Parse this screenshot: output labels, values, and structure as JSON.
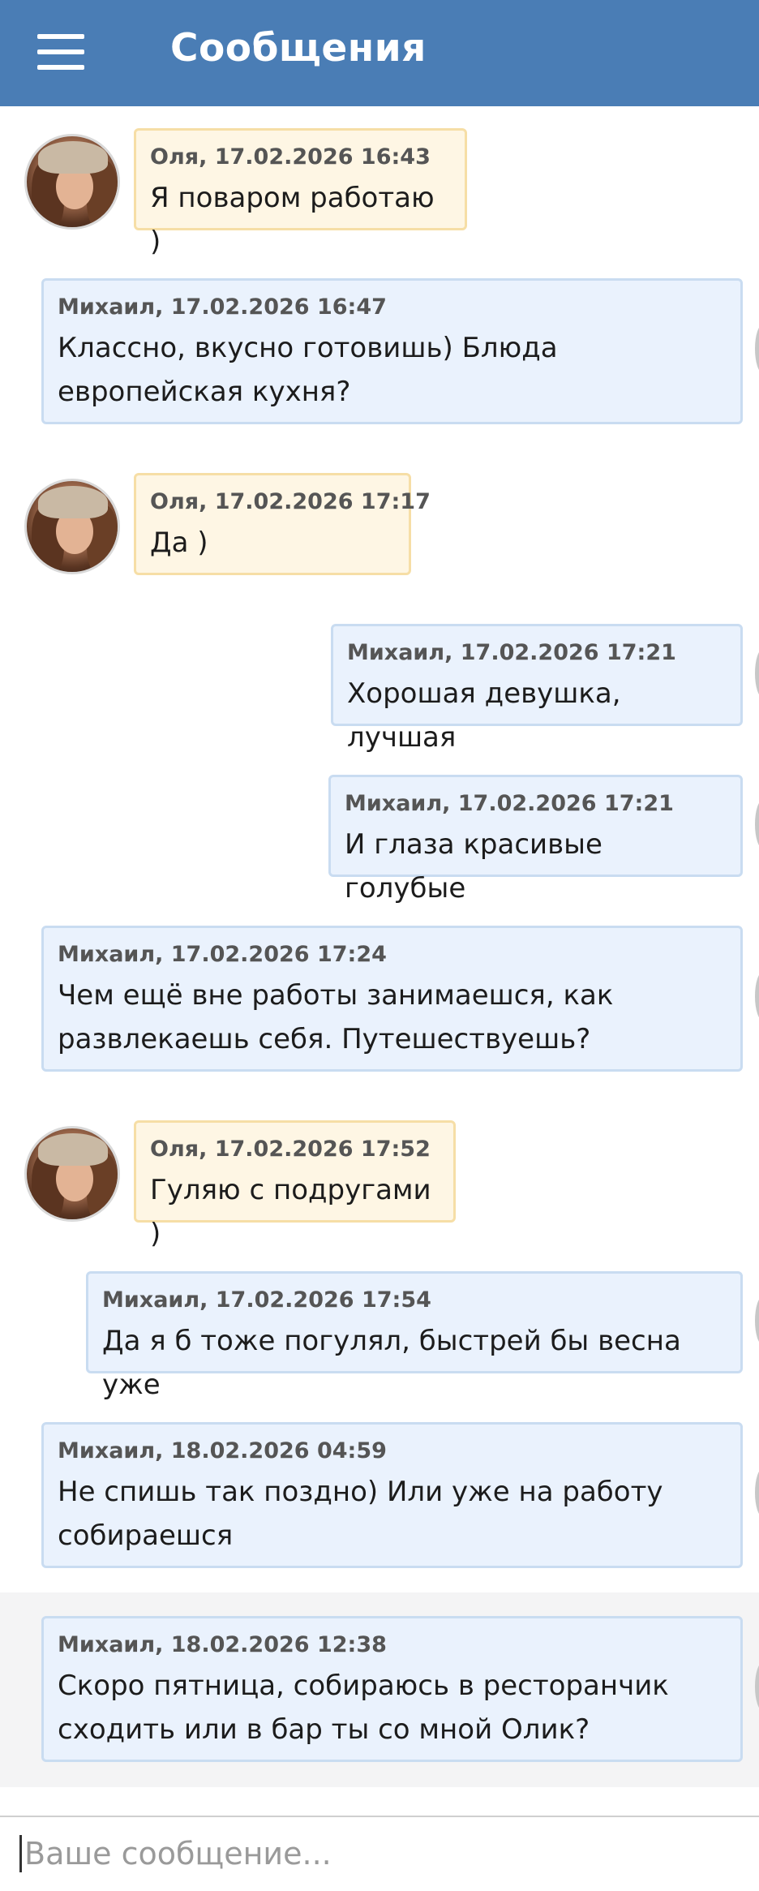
{
  "header": {
    "menu_icon": "hamburger-menu-icon",
    "title": "Сообщения"
  },
  "messages": [
    {
      "author": "Оля",
      "datetime": "17.02.2026 16:43",
      "meta": "Оля, 17.02.2026 16:43",
      "text": "Я поваром работаю )",
      "side": "theirs"
    },
    {
      "author": "Михаил",
      "datetime": "17.02.2026 16:47",
      "meta": "Михаил, 17.02.2026 16:47",
      "text": "Классно, вкусно готовишь) Блюда\nевропейская кухня?",
      "side": "mine"
    },
    {
      "author": "Оля",
      "datetime": "17.02.2026 17:17",
      "meta": "Оля, 17.02.2026 17:17",
      "text": "Да )",
      "side": "theirs"
    },
    {
      "author": "Михаил",
      "datetime": "17.02.2026 17:21",
      "meta": "Михаил, 17.02.2026 17:21",
      "text": "Хорошая девушка, лучшая",
      "side": "mine"
    },
    {
      "author": "Михаил",
      "datetime": "17.02.2026 17:21",
      "meta": "Михаил, 17.02.2026 17:21",
      "text": "И глаза красивые голубые",
      "side": "mine"
    },
    {
      "author": "Михаил",
      "datetime": "17.02.2026 17:24",
      "meta": "Михаил, 17.02.2026 17:24",
      "text": "Чем ещё вне работы занимаешся, как\nразвлекаешь себя. Путешествуешь?",
      "side": "mine"
    },
    {
      "author": "Оля",
      "datetime": "17.02.2026 17:52",
      "meta": "Оля, 17.02.2026 17:52",
      "text": "Гуляю с подругами )",
      "side": "theirs"
    },
    {
      "author": "Михаил",
      "datetime": "17.02.2026 17:54",
      "meta": "Михаил, 17.02.2026 17:54",
      "text": "Да я б тоже погулял, быстрей бы весна уже",
      "side": "mine"
    },
    {
      "author": "Михаил",
      "datetime": "18.02.2026 04:59",
      "meta": "Михаил, 18.02.2026 04:59",
      "text": "Не спишь так поздно) Или уже на работу\nсобираешся",
      "side": "mine"
    },
    {
      "author": "Михаил",
      "datetime": "18.02.2026 12:38",
      "meta": "Михаил, 18.02.2026 12:38",
      "text": "Скоро пятница, собираюсь в ресторанчик\nсходить или в бар ты со мной Олик?",
      "side": "mine",
      "highlighted": true
    }
  ],
  "compose": {
    "placeholder": "Ваше сообщение...",
    "value": ""
  },
  "colors": {
    "header_bg": "#4a7db5",
    "their_bubble_bg": "#fef6e4",
    "their_bubble_border": "#f6dea6",
    "my_bubble_bg": "#eaf2fd",
    "my_bubble_border": "#c9dcf1"
  }
}
